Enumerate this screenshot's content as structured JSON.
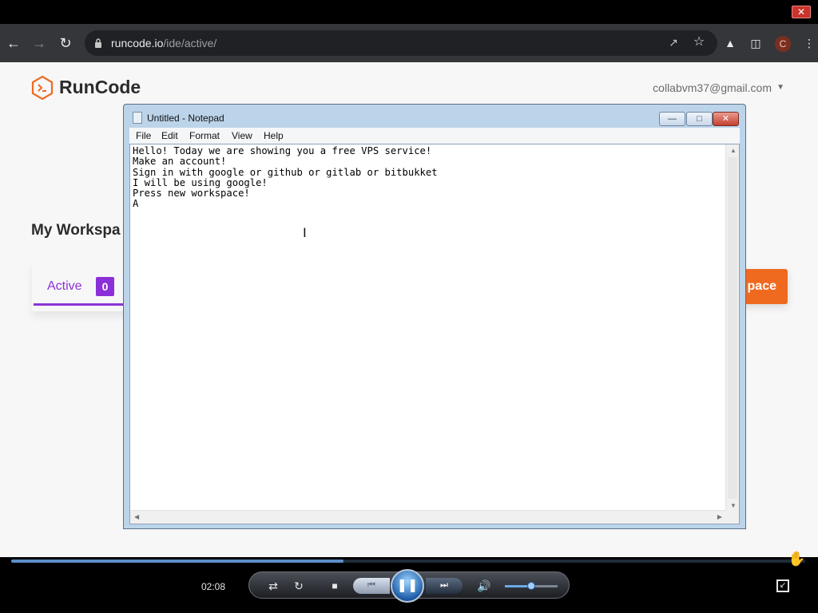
{
  "player": {
    "close_label": "✕",
    "time": "02:08",
    "progress_fraction": 0.419,
    "volume_fraction": 0.5
  },
  "browser": {
    "url_host": "runcode.io",
    "url_path": "/ide/active/",
    "profile_initial": "C",
    "icons": [
      "back-icon",
      "forward-icon",
      "reload-icon",
      "lock-icon",
      "share-icon",
      "star-icon",
      "labs-icon",
      "sidepanel-icon",
      "menu-icon"
    ]
  },
  "page": {
    "brand": "RunCode",
    "account": "collabvm37@gmail.com",
    "workspaces_title": "My Workspa",
    "tab_active_label": "Active",
    "tab_active_count": "0",
    "new_workspace_label": "pace",
    "accent_color": "#8b35d4",
    "button_color": "#ef6a1f",
    "logo_color": "#ef6a1f"
  },
  "notepad": {
    "title": "Untitled - Notepad",
    "menu": [
      "File",
      "Edit",
      "Format",
      "View",
      "Help"
    ],
    "content": "Hello! Today we are showing you a free VPS service!\nMake an account!\nSign in with google or github or gitlab or bitbukket\nI will be using google!\nPress new workspace!\nA"
  }
}
